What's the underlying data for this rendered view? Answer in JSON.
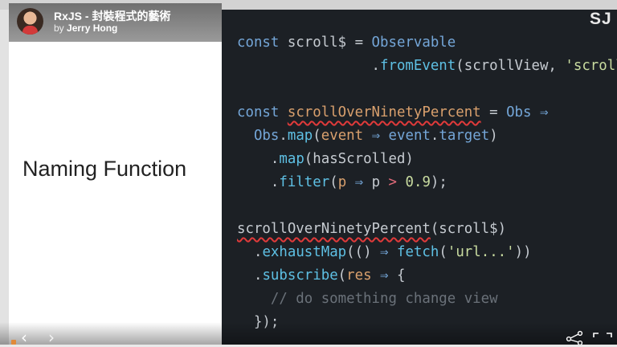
{
  "header": {
    "title": "RxJS - 封裝程式的藝術",
    "by_prefix": "by",
    "author": "Jerry Hong"
  },
  "brand": "SJ",
  "slide": {
    "title": "Naming Function"
  },
  "code": {
    "l1_kw": "const",
    "l1_var": " scroll$ = ",
    "l1_obs": "Observable",
    "l2_indent": "                ",
    "l2_dot": ".",
    "l2_fn": "fromEvent",
    "l2_open": "(scrollView, ",
    "l2_str": "'scroll'",
    "l2_close": ")",
    "l4_kw": "const",
    "l4_space": " ",
    "l4_name": "scrollOverNinetyPercent",
    "l4_eq": " = ",
    "l4_obs": "Obs",
    "l4_arrow": " ⇒",
    "l5_indent": "  ",
    "l5_obs": "Obs",
    "l5_dot": ".",
    "l5_fn": "map",
    "l5_open": "(",
    "l5_p": "event",
    "l5_arrow": " ⇒ ",
    "l5_expr": "event",
    "l5_dot2": ".",
    "l5_prop": "target",
    "l5_close": ")",
    "l6_indent": "    ",
    "l6_dot": ".",
    "l6_fn": "map",
    "l6_rest": "(hasScrolled)",
    "l7_indent": "    ",
    "l7_dot": ".",
    "l7_fn": "filter",
    "l7_open": "(",
    "l7_p": "p",
    "l7_arrow": " ⇒ ",
    "l7_p2": "p",
    "l7_op": " > ",
    "l7_num": "0.9",
    "l7_close": ");",
    "l9_name": "scrollOverNinetyPercent",
    "l9_rest": "(scroll$)",
    "l10_indent": "  ",
    "l10_dot": ".",
    "l10_fn": "exhaustMap",
    "l10_open": "(() ",
    "l10_arrow": "⇒",
    "l10_sp": " ",
    "l10_fn2": "fetch",
    "l10_paren": "(",
    "l10_str": "'url...'",
    "l10_close": "))",
    "l11_indent": "  ",
    "l11_dot": ".",
    "l11_fn": "subscribe",
    "l11_open": "(",
    "l11_p": "res",
    "l11_arrow": " ⇒ ",
    "l11_brace": "{",
    "l12_indent": "    ",
    "l12_comment": "// do something change view",
    "l13_indent": "  ",
    "l13_close": "});"
  },
  "controls": {
    "prev": "‹",
    "next": "›"
  },
  "icons": {
    "share": "share-icon",
    "fullscreen": "fullscreen-icon"
  },
  "colors": {
    "code_bg": "#1c2025",
    "keyword": "#74a6d8",
    "function": "#5ec0e4",
    "string": "#c9dca0",
    "underline": "#e03a3a"
  }
}
